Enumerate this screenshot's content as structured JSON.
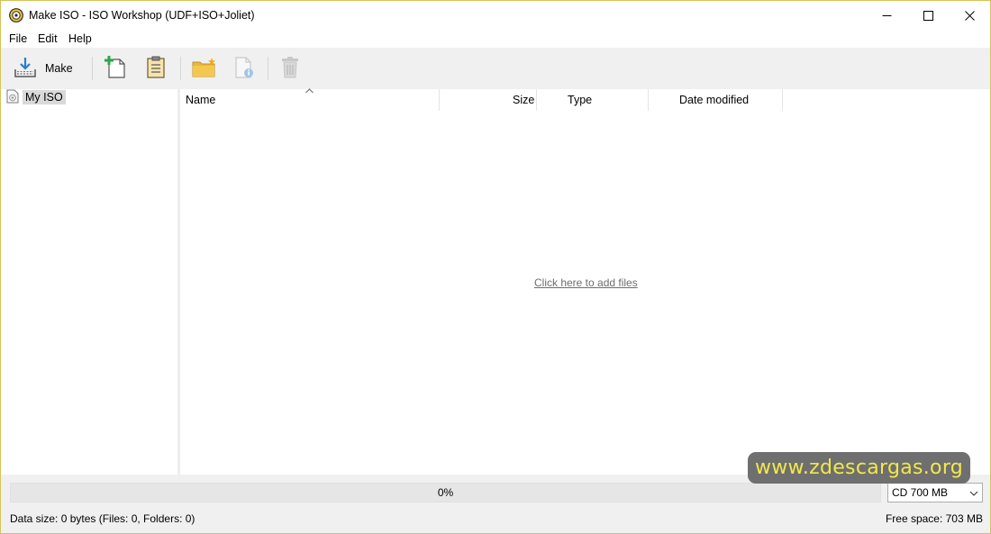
{
  "window": {
    "title": "Make ISO - ISO Workshop (UDF+ISO+Joliet)",
    "icons": {
      "app": "disc-icon",
      "minimize": "minimize-icon",
      "maximize": "maximize-icon",
      "close": "close-icon"
    }
  },
  "menu": {
    "items": [
      {
        "label": "File"
      },
      {
        "label": "Edit"
      },
      {
        "label": "Help"
      }
    ]
  },
  "toolbar": {
    "make_label": "Make",
    "buttons": [
      {
        "name": "make",
        "icon": "make-iso-icon"
      },
      {
        "name": "add-file",
        "icon": "new-file-plus-icon"
      },
      {
        "name": "paste",
        "icon": "clipboard-icon"
      },
      {
        "name": "new-folder",
        "icon": "new-folder-icon"
      },
      {
        "name": "properties",
        "icon": "file-info-icon"
      },
      {
        "name": "delete",
        "icon": "trash-icon"
      }
    ]
  },
  "tree": {
    "root_label": "My ISO",
    "root_icon": "disc-icon"
  },
  "list": {
    "columns": [
      {
        "label": "Name"
      },
      {
        "label": "Size"
      },
      {
        "label": "Type"
      },
      {
        "label": "Date modified"
      }
    ],
    "sorted_column": "Name",
    "sort_direction": "ascending",
    "empty_link": "Click here to add files"
  },
  "progress": {
    "value_percent": 0,
    "text": "0%"
  },
  "media": {
    "selected": "CD 700 MB"
  },
  "status": {
    "data_size": "Data size: 0 bytes (Files: 0, Folders: 0)",
    "free_space": "Free space: 703 MB"
  },
  "watermark": {
    "text": "www.zdescargas.org"
  },
  "colors": {
    "accent_progress": "#06b025",
    "watermark_text": "#f2e84a",
    "watermark_bg": "#6f6f6f",
    "folder": "#e8b93b",
    "plus_green": "#2fa44f",
    "make_blue": "#2a7fc7"
  }
}
